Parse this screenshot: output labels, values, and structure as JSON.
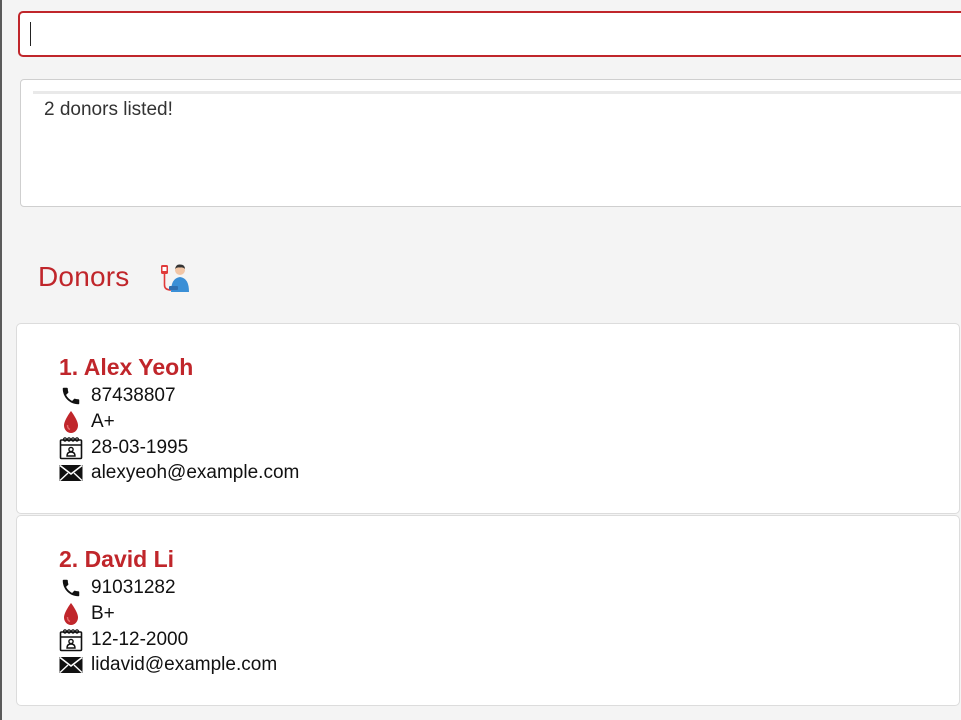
{
  "command": {
    "value": "",
    "placeholder": ""
  },
  "result": {
    "message": "2 donors listed!"
  },
  "list": {
    "title": "Donors",
    "icon": "donor-icon"
  },
  "donors": [
    {
      "name": "1. Alex Yeoh",
      "phone": "87438807",
      "blood_type": "A+",
      "birth_date": "28-03-1995",
      "email": "alexyeoh@example.com"
    },
    {
      "name": "2. David Li",
      "phone": "91031282",
      "blood_type": "B+",
      "birth_date": "12-12-2000",
      "email": "lidavid@example.com"
    }
  ],
  "colors": {
    "accent": "#c0262b",
    "background": "#f4f4f4",
    "card": "#ffffff"
  },
  "icons": {
    "phone": "phone-icon",
    "blood": "blood-drop-icon",
    "birthday": "calendar-icon",
    "email": "email-icon"
  }
}
